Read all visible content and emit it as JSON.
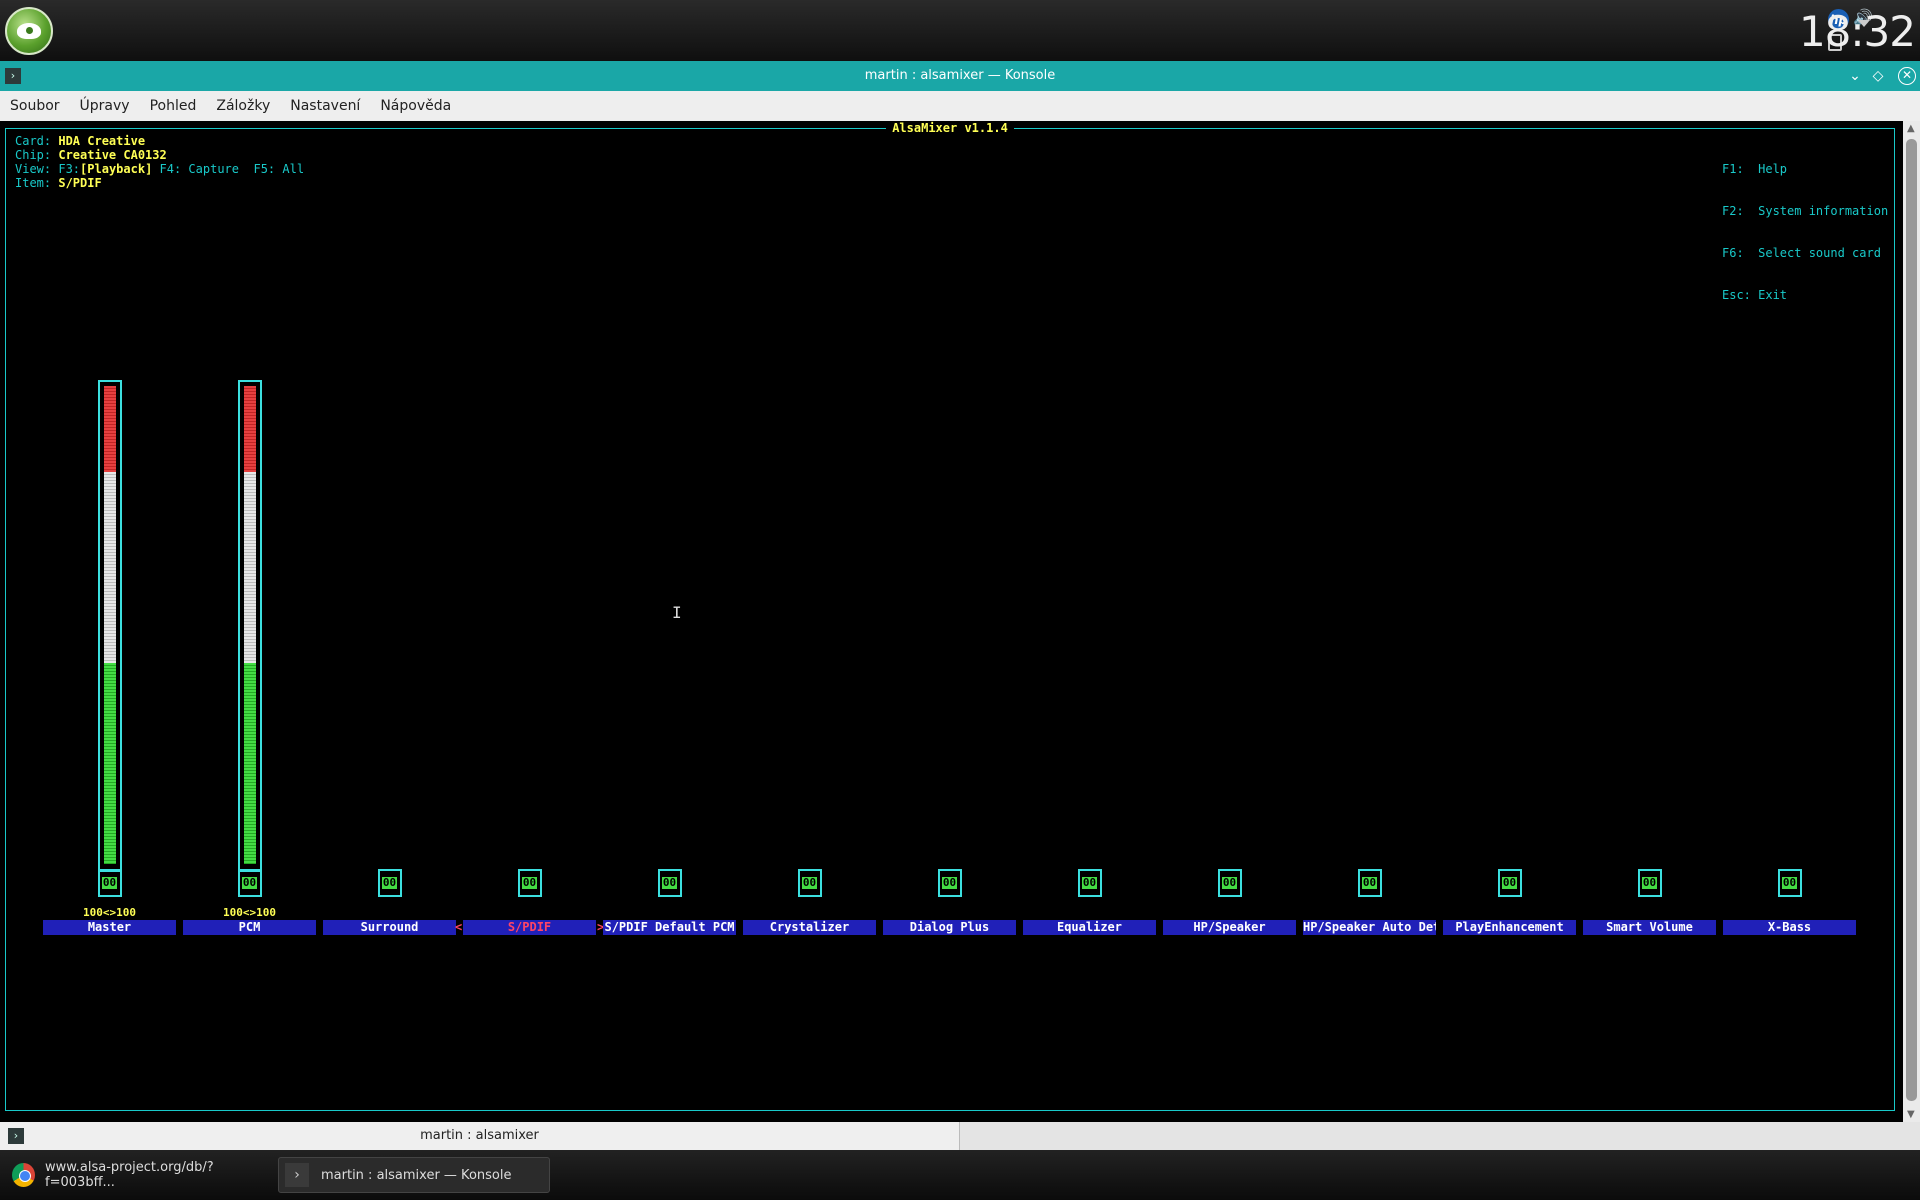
{
  "panel": {
    "clock": "18:32"
  },
  "window": {
    "title": "martin : alsamixer — Konsole",
    "menu": [
      "Soubor",
      "Úpravy",
      "Pohled",
      "Záložky",
      "Nastavení",
      "Nápověda"
    ],
    "tab_label": "martin : alsamixer"
  },
  "mixer": {
    "title": "AlsaMixer v1.1.4",
    "card_label": "Card:",
    "card_value": "HDA Creative",
    "chip_label": "Chip:",
    "chip_value": "Creative CA0132",
    "view_label": "View:",
    "view_f3": "F3:",
    "view_playback": "[Playback]",
    "view_f4": "F4: Capture",
    "view_f5": "F5: All",
    "item_label": "Item:",
    "item_value": "S/PDIF",
    "help": [
      "F1:  Help",
      "F2:  System information",
      "F6:  Select sound card",
      "Esc: Exit"
    ],
    "channels": [
      {
        "name": "Master",
        "has_bar": true,
        "volume": "100<>100",
        "level": 1.0,
        "switch": "00"
      },
      {
        "name": "PCM",
        "has_bar": true,
        "volume": "100<>100",
        "level": 1.0,
        "switch": "00"
      },
      {
        "name": "Surround",
        "has_bar": false,
        "switch": "00"
      },
      {
        "name": "S/PDIF",
        "has_bar": false,
        "switch": "00",
        "selected": true
      },
      {
        "name": "S/PDIF Default PCM",
        "has_bar": false,
        "switch": "00"
      },
      {
        "name": "Crystalizer",
        "has_bar": false,
        "switch": "00"
      },
      {
        "name": "Dialog Plus",
        "has_bar": false,
        "switch": "00"
      },
      {
        "name": "Equalizer",
        "has_bar": false,
        "switch": "00"
      },
      {
        "name": "HP/Speaker",
        "has_bar": false,
        "switch": "00"
      },
      {
        "name": "HP/Speaker Auto Det",
        "has_bar": false,
        "switch": "00"
      },
      {
        "name": "PlayEnhancement",
        "has_bar": false,
        "switch": "00"
      },
      {
        "name": "Smart Volume",
        "has_bar": false,
        "switch": "00"
      },
      {
        "name": "X-Bass",
        "has_bar": false,
        "switch": "00"
      }
    ]
  },
  "taskbar": {
    "items": [
      {
        "label": "www.alsa-project.org/db/?f=003bff...",
        "icon": "chrome-icon"
      },
      {
        "label": "martin : alsamixer — Konsole",
        "icon": "konsole-icon"
      }
    ]
  },
  "colors": {
    "titlebar": "#1aa7a7",
    "frame": "#19c9c9",
    "label_bg": "#2020b8",
    "highlight": "#ffff55",
    "selected": "#ff4466"
  }
}
